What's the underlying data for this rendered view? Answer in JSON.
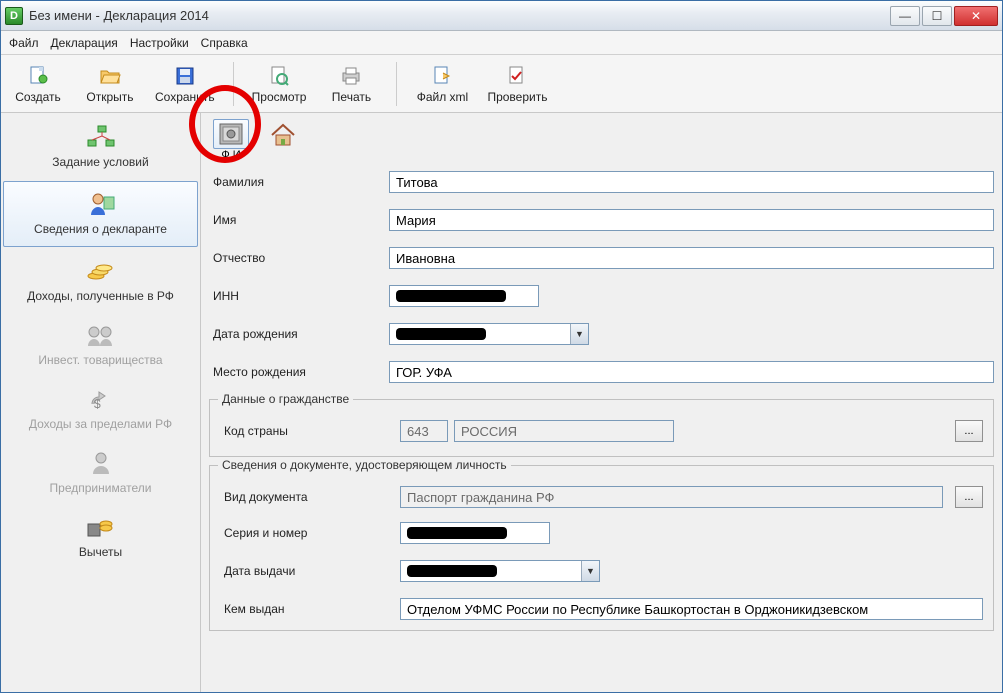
{
  "window": {
    "title": "Без имени - Декларация 2014"
  },
  "menu": {
    "file": "Файл",
    "declaration": "Декларация",
    "settings": "Настройки",
    "help": "Справка"
  },
  "toolbar": {
    "create": "Создать",
    "open": "Открыть",
    "save": "Сохранить",
    "preview": "Просмотр",
    "print": "Печать",
    "xml": "Файл xml",
    "check": "Проверить"
  },
  "sidebar": {
    "items": [
      {
        "label": "Задание условий"
      },
      {
        "label": "Сведения о декларанте"
      },
      {
        "label": "Доходы, полученные в РФ"
      },
      {
        "label": "Инвест. товарищества"
      },
      {
        "label": "Доходы за пределами РФ"
      },
      {
        "label": "Предприниматели"
      },
      {
        "label": "Вычеты"
      }
    ]
  },
  "section_tabs": {
    "fio": "Ф.И"
  },
  "form": {
    "lastname_label": "Фамилия",
    "lastname": "Титова",
    "firstname_label": "Имя",
    "firstname": "Мария",
    "patronymic_label": "Отчество",
    "patronymic": "Ивановна",
    "inn_label": "ИНН",
    "dob_label": "Дата рождения",
    "birthplace_label": "Место рождения",
    "birthplace": "ГОР. УФА"
  },
  "citizenship": {
    "legend": "Данные о гражданстве",
    "country_code_label": "Код страны",
    "country_code": "643",
    "country_name": "РОССИЯ"
  },
  "docinfo": {
    "legend": "Сведения о документе, удостоверяющем личность",
    "doctype_label": "Вид документа",
    "doctype": "Паспорт гражданина РФ",
    "series_label": "Серия и номер",
    "issued_date_label": "Дата выдачи",
    "issued_by_label": "Кем выдан",
    "issued_by": "Отделом УФМС России по Республике Башкортостан в Орджоникидзевском"
  },
  "glyphs": {
    "ellipsis": "..."
  }
}
